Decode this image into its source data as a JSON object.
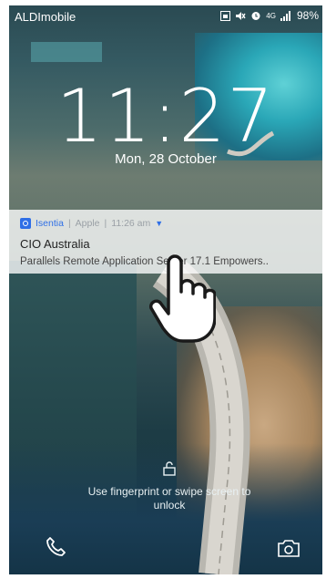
{
  "status_bar": {
    "carrier": "ALDImobile",
    "network": "4G",
    "battery": "98%"
  },
  "lock_screen": {
    "time": "11:27",
    "date": "Mon, 28 October",
    "unlock_hint": "Use fingerprint or swipe screen to unlock"
  },
  "notification": {
    "app_name": "Isentia",
    "category": "Apple",
    "time": "11:26 am",
    "title": "CIO Australia",
    "body": "Parallels Remote Application Server 17.1 Empowers.."
  },
  "icons": {
    "phone": "phone-icon",
    "camera": "camera-icon",
    "lock": "lock-icon",
    "pointer": "hand-pointer-icon"
  },
  "colors": {
    "accent": "#2f6fe6",
    "notification_bg": "#ffffffc7"
  }
}
